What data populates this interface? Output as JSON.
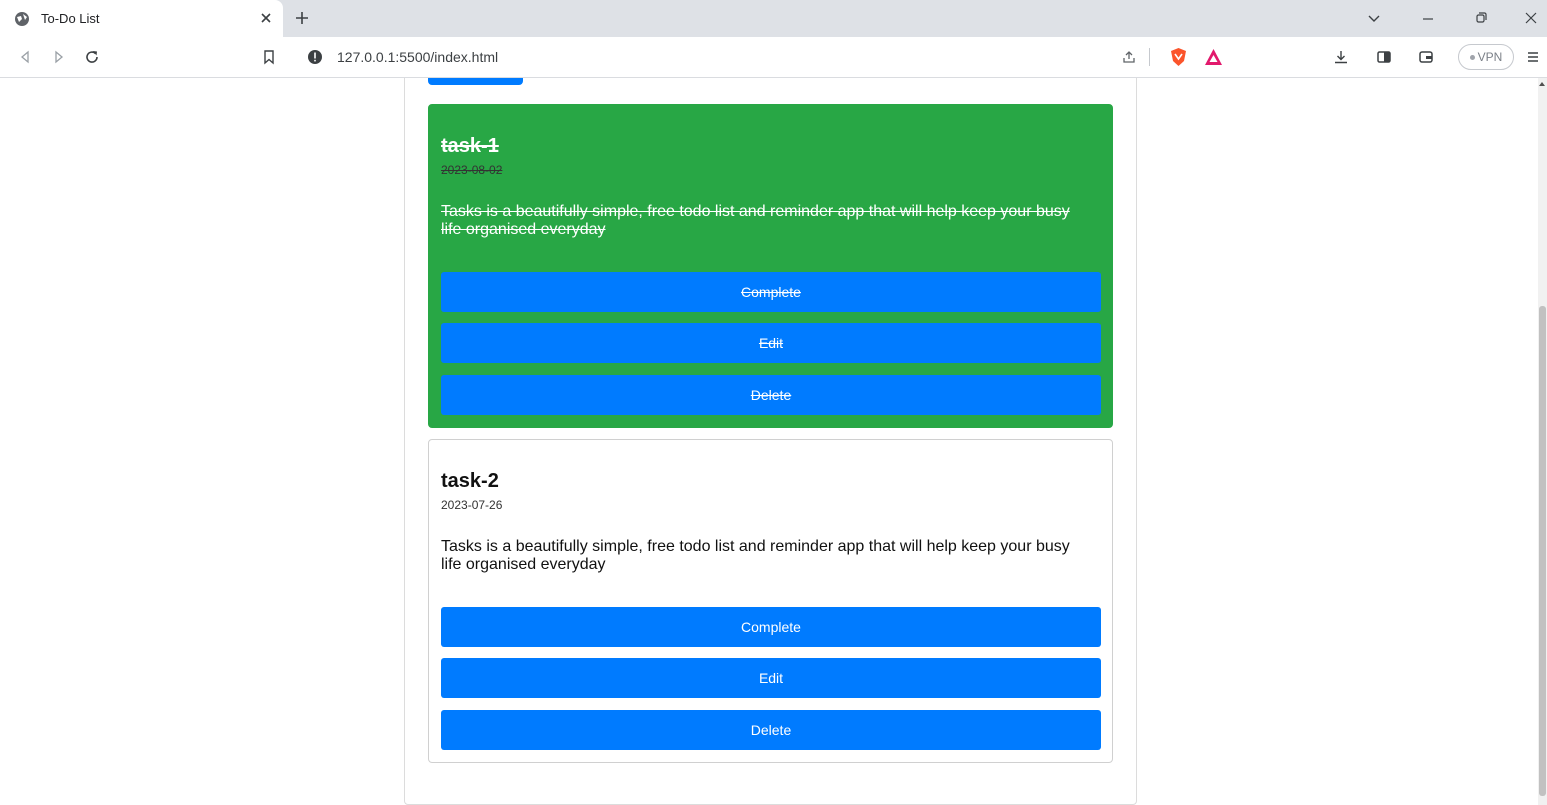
{
  "browser": {
    "tab_title": "To-Do List",
    "url": "127.0.0.1:5500/index.html",
    "vpn_label": "VPN",
    "accent_brave": "#fb542b"
  },
  "page": {
    "button_color": "#007bff",
    "completed_color": "#28a745"
  },
  "tasks": [
    {
      "title": "task-1",
      "date": "2023-08-02",
      "description": "Tasks is a beautifully simple, free todo list and reminder app that will help keep your busy life organised everyday",
      "completed": true,
      "complete_label": "Complete",
      "edit_label": "Edit",
      "delete_label": "Delete"
    },
    {
      "title": "task-2",
      "date": "2023-07-26",
      "description": "Tasks is a beautifully simple, free todo list and reminder app that will help keep your busy life organised everyday",
      "completed": false,
      "complete_label": "Complete",
      "edit_label": "Edit",
      "delete_label": "Delete"
    }
  ]
}
